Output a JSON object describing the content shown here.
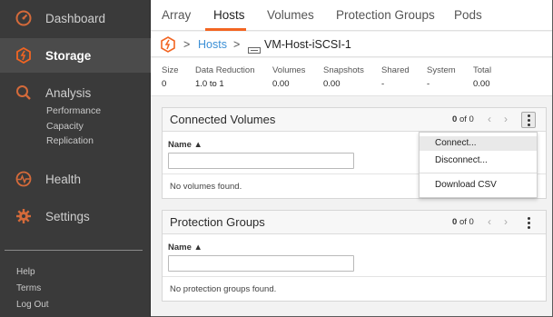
{
  "sidebar": {
    "items": [
      {
        "label": "Dashboard",
        "icon": "dashboard-gauge-icon"
      },
      {
        "label": "Storage",
        "icon": "storage-shield-icon"
      },
      {
        "label": "Analysis",
        "icon": "analysis-magnifier-icon"
      },
      {
        "label": "Health",
        "icon": "health-pulse-icon"
      },
      {
        "label": "Settings",
        "icon": "settings-gear-icon"
      }
    ],
    "analysis_subitems": [
      "Performance",
      "Capacity",
      "Replication"
    ],
    "footer_links": [
      "Help",
      "Terms",
      "Log Out"
    ],
    "accent_color": "#f26522"
  },
  "tabs": [
    "Array",
    "Hosts",
    "Volumes",
    "Protection Groups",
    "Pods"
  ],
  "active_tab": "Hosts",
  "breadcrumb": {
    "sep1": ">",
    "link": "Hosts",
    "sep2": ">",
    "current": "VM-Host-iSCSI-1"
  },
  "stats": {
    "headers": [
      "Size",
      "Data Reduction",
      "Volumes",
      "Snapshots",
      "Shared",
      "System",
      "Total"
    ],
    "values": [
      "0",
      "1.0 to 1",
      "0.00",
      "0.00",
      "-",
      "-",
      "0.00"
    ]
  },
  "connected_volumes": {
    "title": "Connected Volumes",
    "pager_start": "0",
    "pager_text": "of 0",
    "column": "Name ▲",
    "filter_value": "",
    "empty": "No volumes found."
  },
  "protection_groups": {
    "title": "Protection Groups",
    "pager_start": "0",
    "pager_text": "of 0",
    "column": "Name ▲",
    "filter_value": "",
    "empty": "No protection groups found."
  },
  "menu": {
    "items": [
      "Connect...",
      "Disconnect...",
      "Download CSV"
    ]
  },
  "glyphs": {
    "chev_left": "‹",
    "chev_right": "›"
  }
}
